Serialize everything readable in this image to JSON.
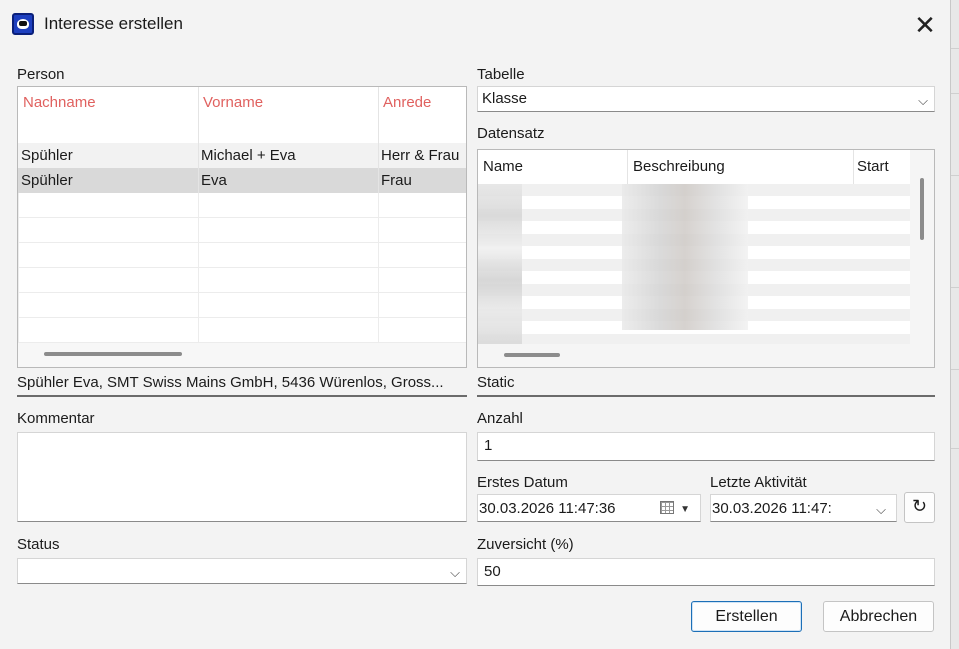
{
  "window": {
    "title": "Interesse erstellen",
    "close_icon": "close-icon"
  },
  "person": {
    "label": "Person",
    "columns": [
      "Nachname",
      "Vorname",
      "Anrede"
    ],
    "rows": [
      [
        "Spühler",
        "Michael + Eva",
        "Herr & Frau"
      ],
      [
        "Spühler",
        "Eva",
        "Frau"
      ]
    ],
    "summary": "Spühler Eva, SMT Swiss Mains GmbH, 5436 Würenlos, Gross..."
  },
  "tabelle": {
    "label": "Tabelle",
    "value": "Klasse"
  },
  "datensatz": {
    "label": "Datensatz",
    "columns": [
      "Name",
      "Beschreibung",
      "Start"
    ]
  },
  "static_label": "Static",
  "kommentar": {
    "label": "Kommentar",
    "value": ""
  },
  "anzahl": {
    "label": "Anzahl",
    "value": "1"
  },
  "erstes_datum": {
    "label": "Erstes Datum",
    "value": "30.03.2026 11:47:36"
  },
  "letzte_aktivitaet": {
    "label": "Letzte Aktivität",
    "value": "30.03.2026 11:47:"
  },
  "status": {
    "label": "Status",
    "value": ""
  },
  "zuversicht": {
    "label": "Zuversicht (%)",
    "value": "50"
  },
  "buttons": {
    "create": "Erstellen",
    "cancel": "Abbrechen"
  },
  "colors": {
    "header_text": "#e0615f",
    "selected_row": "#d9d9d9",
    "primary_border": "#1c6fb7"
  }
}
